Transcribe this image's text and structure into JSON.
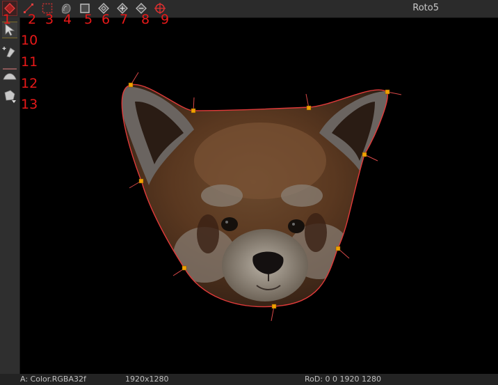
{
  "toolbar": {
    "node_name": "Roto5",
    "tools": [
      {
        "name": "add-shape-tool",
        "label": "1"
      },
      {
        "name": "open-spline-tool",
        "label": "2"
      },
      {
        "name": "rectangle-select-tool",
        "label": "3"
      },
      {
        "name": "feather-link-tool",
        "label": "4"
      },
      {
        "name": "bbox-tool",
        "label": "5"
      },
      {
        "name": "smooth-point-tool",
        "label": "6"
      },
      {
        "name": "add-point-tool",
        "label": "7"
      },
      {
        "name": "remove-point-tool",
        "label": "8"
      },
      {
        "name": "target-center-tool",
        "label": "9"
      }
    ]
  },
  "sidebar": {
    "tools": [
      {
        "name": "select-tool",
        "label": "10"
      },
      {
        "name": "point-edit-tool",
        "label": "11"
      },
      {
        "name": "bezier-tool",
        "label": "12"
      },
      {
        "name": "paint-tool",
        "label": "13"
      }
    ]
  },
  "viewer": {
    "subject": "red panda face inside roto shape"
  },
  "status": {
    "channel": "A: Color.RGBA32f",
    "resolution": "1920x1280",
    "rod": "RoD: 0 0 1920 1280"
  },
  "colors": {
    "accent": "#e81919",
    "roto_curve": "#e03a3a",
    "control_point": "#f0a000"
  }
}
